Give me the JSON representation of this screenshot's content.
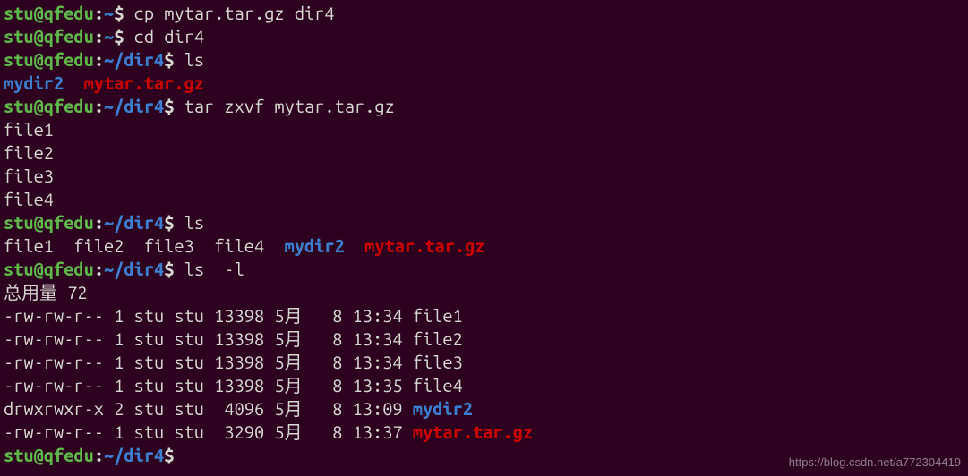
{
  "prompt": {
    "user_host": "stu@qfedu",
    "colon": ":",
    "home": "~",
    "dir4": "~/dir4",
    "dollar": "$"
  },
  "cmd": {
    "cp": " cp mytar.tar.gz dir4",
    "cd": " cd dir4",
    "ls1": " ls",
    "tar": " tar zxvf mytar.tar.gz",
    "ls2": " ls",
    "lsl": " ls  -l",
    "lsl_cursor": "I"
  },
  "out": {
    "ls1_dir": "mydir2",
    "ls1_gap": "  ",
    "ls1_tar": "mytar.tar.gz",
    "tar_lines": [
      "file1",
      "file2",
      "file3",
      "file4"
    ],
    "ls2_files": "file1  file2  file3  file4  ",
    "ls2_dir": "mydir2",
    "ls2_gap": "  ",
    "ls2_tar": "mytar.tar.gz",
    "total": "总用量 72",
    "rows": [
      {
        "perm": "-rw-rw-r--",
        "links": "1",
        "owner": "stu",
        "group": "stu",
        "size": "13398",
        "month": "5月",
        "day": "  8",
        "time": "13:34",
        "name": "file1",
        "type": "file"
      },
      {
        "perm": "-rw-rw-r--",
        "links": "1",
        "owner": "stu",
        "group": "stu",
        "size": "13398",
        "month": "5月",
        "day": "  8",
        "time": "13:34",
        "name": "file2",
        "type": "file"
      },
      {
        "perm": "-rw-rw-r--",
        "links": "1",
        "owner": "stu",
        "group": "stu",
        "size": "13398",
        "month": "5月",
        "day": "  8",
        "time": "13:34",
        "name": "file3",
        "type": "file"
      },
      {
        "perm": "-rw-rw-r--",
        "links": "1",
        "owner": "stu",
        "group": "stu",
        "size": "13398",
        "month": "5月",
        "day": "  8",
        "time": "13:35",
        "name": "file4",
        "type": "file"
      },
      {
        "perm": "drwxrwxr-x",
        "links": "2",
        "owner": "stu",
        "group": "stu",
        "size": " 4096",
        "month": "5月",
        "day": "  8",
        "time": "13:09",
        "name": "mydir2",
        "type": "dir"
      },
      {
        "perm": "-rw-rw-r--",
        "links": "1",
        "owner": "stu",
        "group": "stu",
        "size": " 3290",
        "month": "5月",
        "day": "  8",
        "time": "13:37",
        "name": "mytar.tar.gz",
        "type": "archive"
      }
    ]
  },
  "watermark": "https://blog.csdn.net/a772304419"
}
